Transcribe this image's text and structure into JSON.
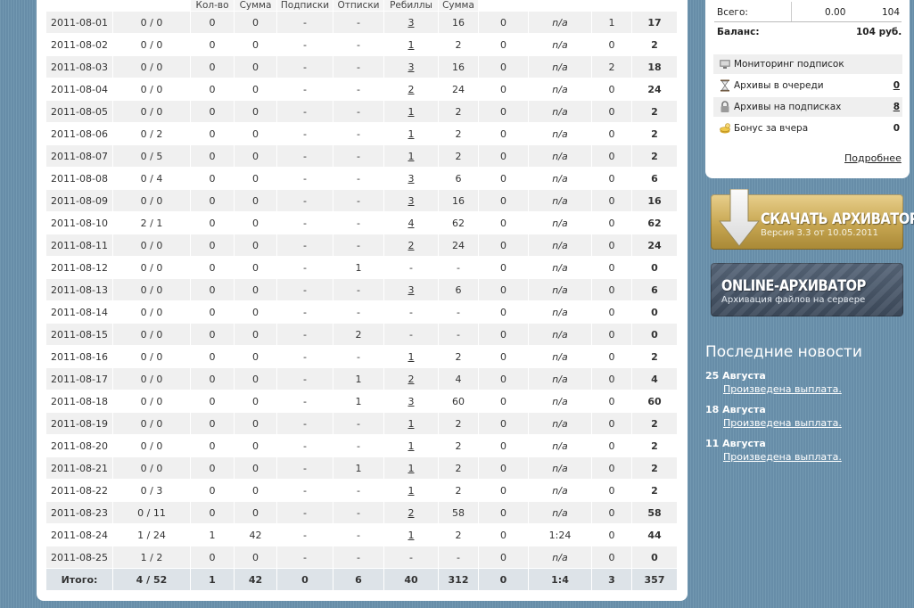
{
  "table": {
    "headers": [
      "",
      "",
      "Кол-во",
      "Сумма",
      "Подписки",
      "Отписки",
      "Ребиллы",
      "Сумма",
      "",
      "",
      "",
      ""
    ],
    "rows": [
      [
        "2011-08-01",
        "0 / 0",
        "0",
        "0",
        "-",
        "-",
        "3",
        "16",
        "0",
        "n/a",
        "1",
        "17"
      ],
      [
        "2011-08-02",
        "0 / 0",
        "0",
        "0",
        "-",
        "-",
        "1",
        "2",
        "0",
        "n/a",
        "0",
        "2"
      ],
      [
        "2011-08-03",
        "0 / 0",
        "0",
        "0",
        "-",
        "-",
        "3",
        "16",
        "0",
        "n/a",
        "2",
        "18"
      ],
      [
        "2011-08-04",
        "0 / 0",
        "0",
        "0",
        "-",
        "-",
        "2",
        "24",
        "0",
        "n/a",
        "0",
        "24"
      ],
      [
        "2011-08-05",
        "0 / 0",
        "0",
        "0",
        "-",
        "-",
        "1",
        "2",
        "0",
        "n/a",
        "0",
        "2"
      ],
      [
        "2011-08-06",
        "0 / 2",
        "0",
        "0",
        "-",
        "-",
        "1",
        "2",
        "0",
        "n/a",
        "0",
        "2"
      ],
      [
        "2011-08-07",
        "0 / 5",
        "0",
        "0",
        "-",
        "-",
        "1",
        "2",
        "0",
        "n/a",
        "0",
        "2"
      ],
      [
        "2011-08-08",
        "0 / 4",
        "0",
        "0",
        "-",
        "-",
        "3",
        "6",
        "0",
        "n/a",
        "0",
        "6"
      ],
      [
        "2011-08-09",
        "0 / 0",
        "0",
        "0",
        "-",
        "-",
        "3",
        "16",
        "0",
        "n/a",
        "0",
        "16"
      ],
      [
        "2011-08-10",
        "2 / 1",
        "0",
        "0",
        "-",
        "-",
        "4",
        "62",
        "0",
        "n/a",
        "0",
        "62"
      ],
      [
        "2011-08-11",
        "0 / 0",
        "0",
        "0",
        "-",
        "-",
        "2",
        "24",
        "0",
        "n/a",
        "0",
        "24"
      ],
      [
        "2011-08-12",
        "0 / 0",
        "0",
        "0",
        "-",
        "1",
        "-",
        "-",
        "0",
        "n/a",
        "0",
        "0"
      ],
      [
        "2011-08-13",
        "0 / 0",
        "0",
        "0",
        "-",
        "-",
        "3",
        "6",
        "0",
        "n/a",
        "0",
        "6"
      ],
      [
        "2011-08-14",
        "0 / 0",
        "0",
        "0",
        "-",
        "-",
        "-",
        "-",
        "0",
        "n/a",
        "0",
        "0"
      ],
      [
        "2011-08-15",
        "0 / 0",
        "0",
        "0",
        "-",
        "2",
        "-",
        "-",
        "0",
        "n/a",
        "0",
        "0"
      ],
      [
        "2011-08-16",
        "0 / 0",
        "0",
        "0",
        "-",
        "-",
        "1",
        "2",
        "0",
        "n/a",
        "0",
        "2"
      ],
      [
        "2011-08-17",
        "0 / 0",
        "0",
        "0",
        "-",
        "1",
        "2",
        "4",
        "0",
        "n/a",
        "0",
        "4"
      ],
      [
        "2011-08-18",
        "0 / 0",
        "0",
        "0",
        "-",
        "1",
        "3",
        "60",
        "0",
        "n/a",
        "0",
        "60"
      ],
      [
        "2011-08-19",
        "0 / 0",
        "0",
        "0",
        "-",
        "-",
        "1",
        "2",
        "0",
        "n/a",
        "0",
        "2"
      ],
      [
        "2011-08-20",
        "0 / 0",
        "0",
        "0",
        "-",
        "-",
        "1",
        "2",
        "0",
        "n/a",
        "0",
        "2"
      ],
      [
        "2011-08-21",
        "0 / 0",
        "0",
        "0",
        "-",
        "1",
        "1",
        "2",
        "0",
        "n/a",
        "0",
        "2"
      ],
      [
        "2011-08-22",
        "0 / 3",
        "0",
        "0",
        "-",
        "-",
        "1",
        "2",
        "0",
        "n/a",
        "0",
        "2"
      ],
      [
        "2011-08-23",
        "0 / 11",
        "0",
        "0",
        "-",
        "-",
        "2",
        "58",
        "0",
        "n/a",
        "0",
        "58"
      ],
      [
        "2011-08-24",
        "1 / 24",
        "1",
        "42",
        "-",
        "-",
        "1",
        "2",
        "0",
        "1:24",
        "0",
        "44"
      ],
      [
        "2011-08-25",
        "1 / 2",
        "0",
        "0",
        "-",
        "-",
        "-",
        "-",
        "0",
        "n/a",
        "0",
        "0"
      ]
    ],
    "total": [
      "Итого:",
      "4 / 52",
      "1",
      "42",
      "0",
      "6",
      "40",
      "312",
      "0",
      "1:4",
      "3",
      "357"
    ]
  },
  "balance": {
    "total_label": "Всего:",
    "total_amount": "0.00",
    "total_value": "104",
    "balance_label": "Баланс:",
    "balance_value": "104 руб."
  },
  "menu": [
    {
      "icon": "monitor-icon",
      "label": "Мониторинг подписок",
      "value": ""
    },
    {
      "icon": "hourglass-icon",
      "label": "Архивы в очереди",
      "value": "0"
    },
    {
      "icon": "lock-icon",
      "label": "Архивы на подписках",
      "value": "8"
    },
    {
      "icon": "coins-icon",
      "label": "Бонус за вчера",
      "value": "0"
    }
  ],
  "more_link": "Подробнее",
  "download_banner": {
    "title": "СКАЧАТЬ АРХИВАТОР",
    "subtitle": "Версия 3.3 от 10.05.2011"
  },
  "online_banner": {
    "title": "ONLINE-АРХИВАТОР",
    "subtitle": "Архивация файлов на сервере"
  },
  "news": {
    "title": "Последние новости",
    "items": [
      {
        "date": "25 Августа",
        "text": "Произведена выплата."
      },
      {
        "date": "18 Августа",
        "text": "Произведена выплата."
      },
      {
        "date": "11 Августа",
        "text": "Произведена выплата."
      }
    ]
  }
}
